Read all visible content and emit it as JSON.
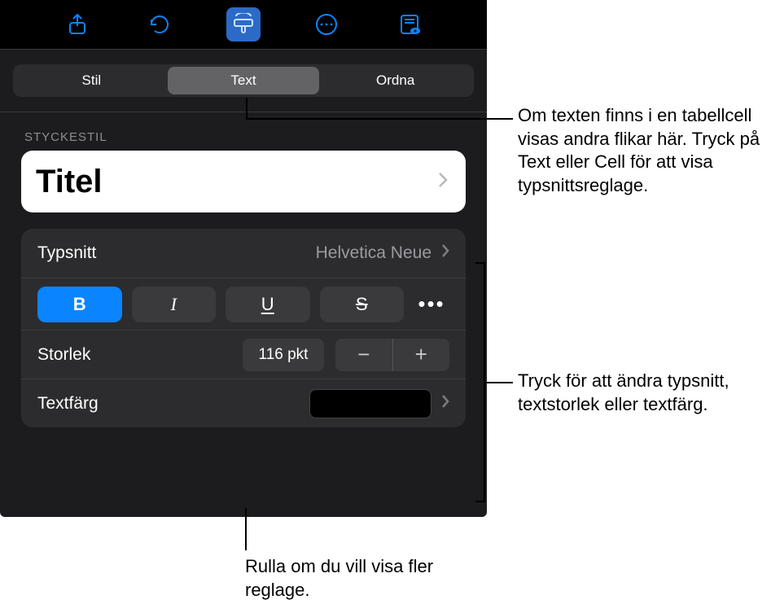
{
  "toolbar": {
    "icons": {
      "share": "share-icon",
      "undo": "undo-icon",
      "format": "format-brush-icon",
      "more": "more-circle-icon",
      "view": "view-eye-icon"
    }
  },
  "tabs": {
    "stil": "Stil",
    "text": "Text",
    "ordna": "Ordna"
  },
  "section": {
    "styckestil": "STYCKESTIL"
  },
  "style_row": {
    "title": "Titel"
  },
  "font_row": {
    "label": "Typsnitt",
    "value": "Helvetica Neue"
  },
  "bius": {
    "b": "B",
    "i": "I",
    "u": "U",
    "s": "S"
  },
  "size_row": {
    "label": "Storlek",
    "value": "116 pkt"
  },
  "color_row": {
    "label": "Textfärg",
    "value": "#000000"
  },
  "callouts": {
    "top": "Om texten finns i en tabellcell visas andra flikar här. Tryck på Text eller Cell för att visa typsnittsreglage.",
    "mid": "Tryck för att ändra typsnitt, textstorlek eller textfärg.",
    "bot": "Rulla om du vill visa fler reglage."
  }
}
